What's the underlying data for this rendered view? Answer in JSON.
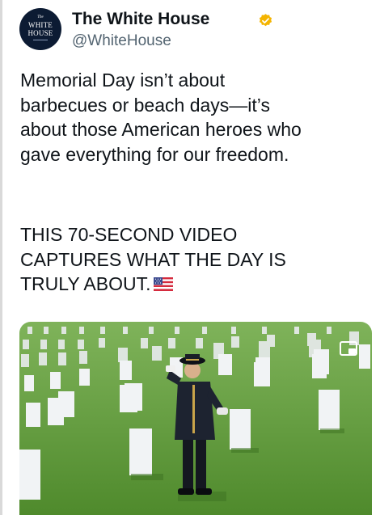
{
  "tweet": {
    "author": {
      "avatar_text": {
        "line1": "The",
        "line2": "WHITE",
        "line3": "HOUSE"
      },
      "display_name": "The White House",
      "handle": "@WhiteHouse",
      "verified_badge_icon": "verified-badge-icon",
      "verified_color": "#f4b400"
    },
    "paragraph_1": "Memorial Day isn’t about\nbarbecues or beach days—it’s\nabout those American heroes who\ngave everything for our freedom.",
    "paragraph_2": "THIS 70-SECOND VIDEO\nCAPTURES WHAT THE DAY IS\nTRULY ABOUT.",
    "flag_emoji_icon": "us-flag-emoji-icon",
    "media": {
      "type": "video-thumbnail",
      "scene_icon": "soldier-saluting-in-cemetery-image",
      "pip_icon": "picture-in-picture-icon"
    }
  },
  "colors": {
    "text": "#0f1419",
    "secondary_text": "#536471",
    "avatar_bg": "#0c1b33",
    "grass": "#5d9a3a"
  }
}
